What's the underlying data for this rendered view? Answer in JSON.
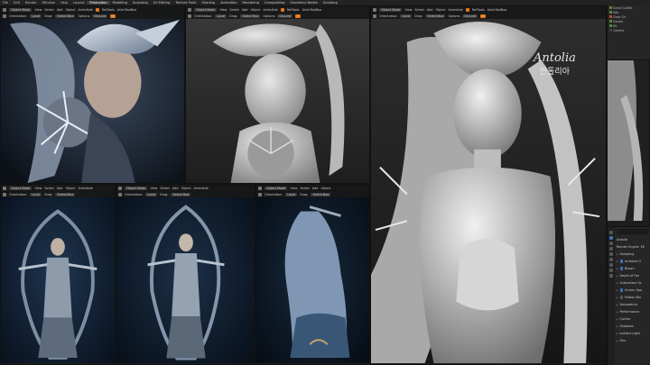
{
  "topbar": {
    "menus": [
      "File",
      "Edit",
      "Render",
      "Window",
      "Help"
    ],
    "workspaces": [
      "Layout",
      "Production",
      "Modeling",
      "Sculpting",
      "UV Editing",
      "Texture Paint",
      "Shading",
      "Animation",
      "Rendering",
      "Compositing",
      "Geometry Nodes",
      "Scripting"
    ],
    "active_workspace": "Production"
  },
  "viewport_header": {
    "mode": "Object Mode",
    "menus": [
      "View",
      "Select",
      "Add",
      "Object"
    ],
    "addons": [
      "AnimAide",
      "RetTools",
      "AnimToolBox"
    ],
    "orientation_label": "Orientation:",
    "orientation_value": "Local",
    "drag_label": "Drag:",
    "drag_value": "Select Box",
    "options_label": "Options",
    "pivot_label": "Ground"
  },
  "outliner": {
    "rows": [
      {
        "label": "Scene Collect",
        "state": "on"
      },
      {
        "label": "Hair",
        "state": "on"
      },
      {
        "label": "Clear Gri",
        "state": "red"
      },
      {
        "label": "Cosmo",
        "state": "on"
      },
      {
        "label": "Kit",
        "state": "on"
      },
      {
        "label": "Camera",
        "state": "off"
      }
    ]
  },
  "properties": {
    "search_placeholder": "⌕",
    "object_name": "Antolia",
    "render_engine_label": "Render Engine",
    "render_engine_value": "EE",
    "sections": [
      {
        "label": "Sampling",
        "check": null
      },
      {
        "label": "Ambient O",
        "check": true
      },
      {
        "label": "Bloom",
        "check": true
      },
      {
        "label": "Depth of Fiel",
        "check": null
      },
      {
        "label": "Subsurface Sc",
        "check": null
      },
      {
        "label": "Screen Spa",
        "check": true
      },
      {
        "label": "Motion Blu",
        "check": false
      },
      {
        "label": "Volumetrics",
        "check": null
      },
      {
        "label": "Performance",
        "check": null
      },
      {
        "label": "Curves",
        "check": null
      },
      {
        "label": "Shadows",
        "check": null
      },
      {
        "label": "Indirect Light",
        "check": null
      },
      {
        "label": "Film",
        "check": null
      }
    ]
  },
  "watermark": {
    "title": "Antolia",
    "subtitle": "안톨리아"
  }
}
